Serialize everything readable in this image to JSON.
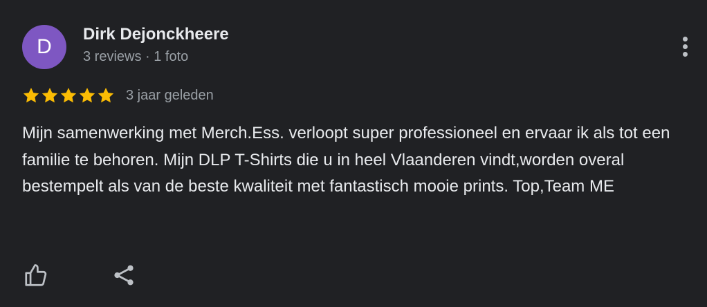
{
  "review": {
    "author": {
      "initial": "D",
      "name": "Dirk Dejonckheere",
      "meta": "3 reviews · 1 foto",
      "avatar_color": "#7e57c2"
    },
    "rating": 5,
    "max_rating": 5,
    "star_color": "#fbbc04",
    "time": "3 jaar geleden",
    "text": "Mijn samenwerking met Merch.Ess. verloopt super professioneel en ervaar ik als tot een familie te behoren. Mijn DLP T-Shirts die u in heel Vlaanderen vindt,worden overal bestempelt als van de beste kwaliteit met fantastisch mooie prints. Top,Team ME"
  },
  "actions": {
    "more_icon": "more-vert-icon",
    "like_icon": "thumb-up-icon",
    "share_icon": "share-icon"
  }
}
